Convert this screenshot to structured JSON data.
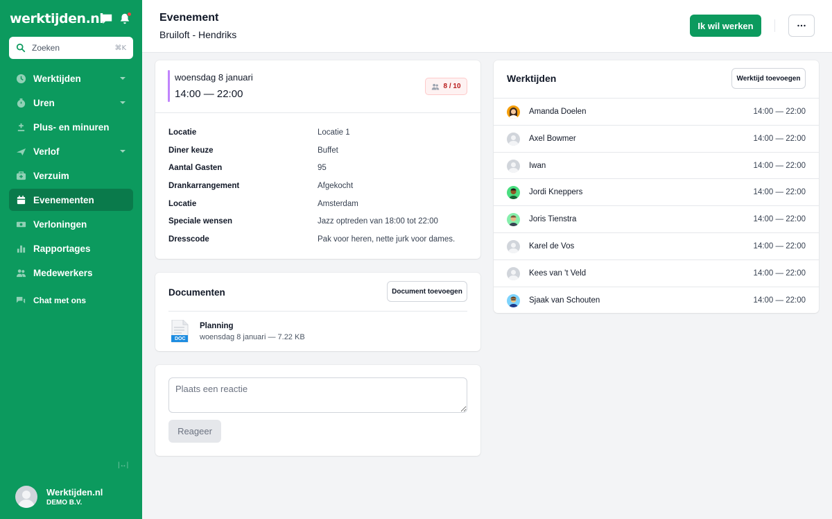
{
  "brand": {
    "logo": "werktijden.nl",
    "accent": "#0c9a5e"
  },
  "search": {
    "placeholder": "Zoeken",
    "shortcut": "⌘K"
  },
  "nav": {
    "items": [
      {
        "label": "Werktijden",
        "icon": "clock-icon",
        "has_children": true
      },
      {
        "label": "Uren",
        "icon": "stopwatch-icon",
        "has_children": true
      },
      {
        "label": "Plus- en minuren",
        "icon": "plus-minus-icon",
        "has_children": false
      },
      {
        "label": "Verlof",
        "icon": "plane-icon",
        "has_children": true
      },
      {
        "label": "Verzuim",
        "icon": "medkit-icon",
        "has_children": false
      },
      {
        "label": "Evenementen",
        "icon": "calendar-icon",
        "has_children": false,
        "active": true
      },
      {
        "label": "Verloningen",
        "icon": "money-icon",
        "has_children": false
      },
      {
        "label": "Rapportages",
        "icon": "chart-icon",
        "has_children": false
      },
      {
        "label": "Medewerkers",
        "icon": "users-icon",
        "has_children": false
      }
    ],
    "chat": "Chat met ons",
    "collapse": "|↔|"
  },
  "profile": {
    "name": "Werktijden.nl",
    "company": "DEMO B.V."
  },
  "header": {
    "title": "Evenement",
    "subtitle": "Bruiloft - Hendriks",
    "primary_button": "Ik wil werken"
  },
  "event": {
    "date": "woensdag 8 januari",
    "time": "14:00 — 22:00",
    "capacity": "8 / 10",
    "details": [
      {
        "label": "Locatie",
        "value": "Locatie 1"
      },
      {
        "label": "Diner keuze",
        "value": "Buffet"
      },
      {
        "label": "Aantal Gasten",
        "value": "95"
      },
      {
        "label": "Drankarrangement",
        "value": "Afgekocht"
      },
      {
        "label": "Locatie",
        "value": "Amsterdam"
      },
      {
        "label": "Speciale wensen",
        "value": "Jazz optreden van 18:00 tot 22:00"
      },
      {
        "label": "Dresscode",
        "value": "Pak voor heren, nette jurk voor dames."
      }
    ]
  },
  "documents": {
    "title": "Documenten",
    "add_button": "Document toevoegen",
    "items": [
      {
        "name": "Planning",
        "meta": "woensdag 8 januari — 7.22 KB",
        "type": "DOC"
      }
    ]
  },
  "comment": {
    "placeholder": "Plaats een reactie",
    "button": "Reageer"
  },
  "worktimes": {
    "title": "Werktijden",
    "add_button": "Werktijd toevoegen",
    "items": [
      {
        "name": "Amanda Doelen",
        "time": "14:00 — 22:00",
        "avatar": "photo",
        "color": "#f59e0b"
      },
      {
        "name": "Axel Bowmer",
        "time": "14:00 — 22:00",
        "avatar": "placeholder",
        "color": "#d1d5db"
      },
      {
        "name": "Iwan",
        "time": "14:00 — 22:00",
        "avatar": "placeholder",
        "color": "#d1d5db"
      },
      {
        "name": "Jordi Kneppers",
        "time": "14:00 — 22:00",
        "avatar": "photo",
        "color": "#4ade80"
      },
      {
        "name": "Joris Tienstra",
        "time": "14:00 — 22:00",
        "avatar": "photo",
        "color": "#86efac"
      },
      {
        "name": "Karel de Vos",
        "time": "14:00 — 22:00",
        "avatar": "placeholder",
        "color": "#d1d5db"
      },
      {
        "name": "Kees van 't Veld",
        "time": "14:00 — 22:00",
        "avatar": "placeholder",
        "color": "#d1d5db"
      },
      {
        "name": "Sjaak van Schouten",
        "time": "14:00 — 22:00",
        "avatar": "photo",
        "color": "#7dd3fc"
      }
    ]
  }
}
